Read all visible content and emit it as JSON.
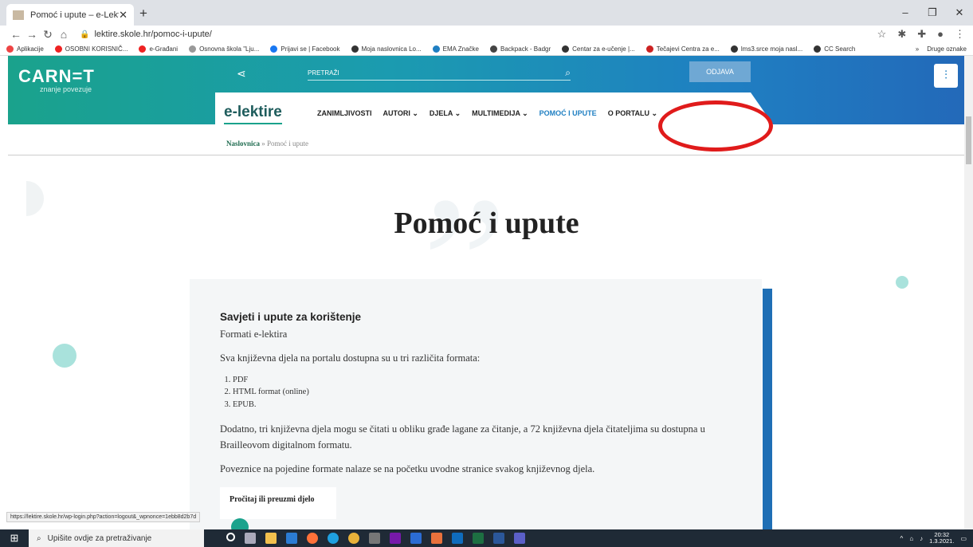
{
  "browser": {
    "tab_title": "Pomoć i upute – e-Lektire",
    "tab_close": "✕",
    "new_tab": "+",
    "url": "lektire.skole.hr/pomoc-i-upute/",
    "window_min": "–",
    "window_max": "❐",
    "window_close": "✕"
  },
  "bookmarks": [
    {
      "label": "Aplikacije",
      "color": "#e44"
    },
    {
      "label": "OSOBNI KORISNIČ...",
      "color": "#e22"
    },
    {
      "label": "e-Građani",
      "color": "#e22"
    },
    {
      "label": "Osnovna škola \"Lju...",
      "color": "#999"
    },
    {
      "label": "Prijavi se | Facebook",
      "color": "#1877f2"
    },
    {
      "label": "Moja naslovnica Lo...",
      "color": "#333"
    },
    {
      "label": "EMA Značke",
      "color": "#1f7fc2"
    },
    {
      "label": "Backpack - Badgr",
      "color": "#444"
    },
    {
      "label": "Centar za e-učenje |...",
      "color": "#333"
    },
    {
      "label": "Tečajevi Centra za e...",
      "color": "#c22"
    },
    {
      "label": "lms3.srce moja nasl...",
      "color": "#333"
    },
    {
      "label": "CC Search",
      "color": "#333"
    }
  ],
  "bookmarks_other": "Druge oznake",
  "site": {
    "logo": "CARN=T",
    "logo_sub": "znanje povezuje",
    "search_placeholder": "PRETRAŽI",
    "logout": "ODJAVA",
    "brand": "e-lektire",
    "nav": [
      {
        "label": "ZANIMLJIVOSTI"
      },
      {
        "label": "AUTORI ⌄"
      },
      {
        "label": "DJELA ⌄"
      },
      {
        "label": "MULTIMEDIJA ⌄"
      },
      {
        "label": "POMOĆ I UPUTE"
      },
      {
        "label": "O PORTALU ⌄"
      }
    ],
    "breadcrumb_home": "Naslovnica",
    "breadcrumb_sep": " » ",
    "breadcrumb_current": "Pomoć i upute",
    "page_title": "Pomoć i upute"
  },
  "card": {
    "heading": "Savjeti i upute za korištenje",
    "subheading": "Formati e-lektira",
    "intro": "Sva književna djela na portalu dostupna su u tri različita formata:",
    "formats": [
      "PDF",
      "HTML format (online)",
      "EPUB."
    ],
    "para2": "Dodatno, tri književna djela mogu se čitati u obliku građe lagane za čitanje, a 72 književna djela čitateljima su dostupna u Brailleovom digitalnom formatu.",
    "para3": "Poveznice na pojedine formate nalaze se na početku uvodne stranice svakog književnog djela.",
    "download_box": "Pročitaj ili preuzmi djelo"
  },
  "status_url": "https://lektire.skole.hr/wp-login.php?action=logout&_wpnonce=1ebb8d2b7d",
  "taskbar": {
    "search_placeholder": "Upišite ovdje za pretraživanje",
    "time": "20:32",
    "date": "1.3.2021."
  }
}
